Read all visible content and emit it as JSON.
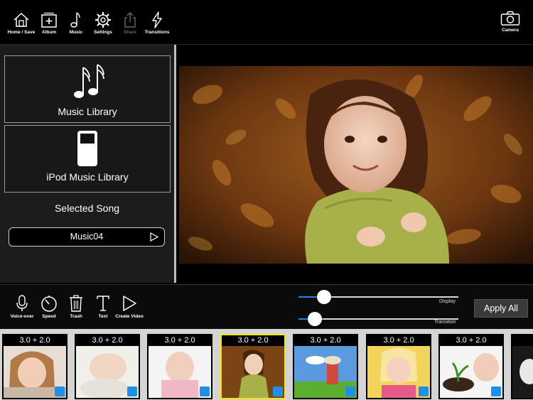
{
  "toolbar": {
    "items": [
      {
        "label": "Home / Save",
        "icon": "home-save-icon",
        "enabled": true
      },
      {
        "label": "Album",
        "icon": "album-add-icon",
        "enabled": true
      },
      {
        "label": "Music",
        "icon": "music-note-icon",
        "enabled": true
      },
      {
        "label": "Settings",
        "icon": "gear-icon",
        "enabled": true
      },
      {
        "label": "Share",
        "icon": "share-icon",
        "enabled": false
      },
      {
        "label": "Transitions",
        "icon": "lightning-icon",
        "enabled": true
      }
    ],
    "camera_label": "Camera"
  },
  "music_panel": {
    "music_library_label": "Music Library",
    "ipod_library_label": "iPod Music Library",
    "selected_song_title": "Selected Song",
    "selected_song_value": "Music04"
  },
  "edit_toolbar": {
    "items": [
      {
        "label": "Voice-over",
        "icon": "microphone-icon"
      },
      {
        "label": "Speed",
        "icon": "stopwatch-icon"
      },
      {
        "label": "Trash",
        "icon": "trash-icon"
      },
      {
        "label": "Text",
        "icon": "text-icon"
      },
      {
        "label": "Create Video",
        "icon": "play-icon"
      }
    ]
  },
  "sliders": {
    "display_label": "Display",
    "display_value": 0.16,
    "transition_label": "Transition",
    "transition_value": 0.1
  },
  "apply_all_label": "Apply All",
  "clips": [
    {
      "time": "3.0 + 2.0",
      "selected": false
    },
    {
      "time": "3.0 + 2.0",
      "selected": false
    },
    {
      "time": "3.0 + 2.0",
      "selected": false
    },
    {
      "time": "3.0 + 2.0",
      "selected": true
    },
    {
      "time": "3.0 + 2.0",
      "selected": false
    },
    {
      "time": "3.0 + 2.0",
      "selected": false
    },
    {
      "time": "3.0 + 2.0",
      "selected": false
    },
    {
      "time": "",
      "selected": false
    }
  ],
  "colors": {
    "accent": "#2d7ff0",
    "selected_clip_border": "#f2e61a",
    "badge": "#1f8fe8"
  }
}
